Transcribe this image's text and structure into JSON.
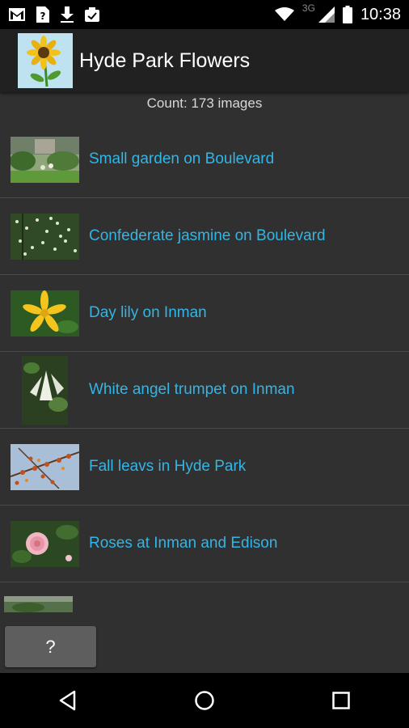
{
  "status_bar": {
    "time": "10:38",
    "network": "3G",
    "left_icons": [
      "gmail-icon",
      "sim-question-icon",
      "download-icon",
      "clipboard-check-icon"
    ],
    "right_icons": [
      "wifi-icon",
      "signal-icon",
      "battery-icon"
    ]
  },
  "action_bar": {
    "title": "Hyde Park Flowers",
    "icon": "sunflower-icon"
  },
  "count_text": "Count: 173 images",
  "items": [
    {
      "label": "Small garden on Boulevard"
    },
    {
      "label": "Confederate jasmine on Boulevard"
    },
    {
      "label": "Day lily on Inman"
    },
    {
      "label": "White angel trumpet on Inman"
    },
    {
      "label": "Fall leavs in Hyde Park"
    },
    {
      "label": "Roses at Inman and Edison"
    }
  ],
  "help_button": {
    "label": "?"
  },
  "nav_bar": {
    "buttons": [
      "back-icon",
      "home-icon",
      "recents-icon"
    ]
  },
  "colors": {
    "link": "#33b5e5",
    "background": "#303030",
    "action_bar": "#212121"
  }
}
